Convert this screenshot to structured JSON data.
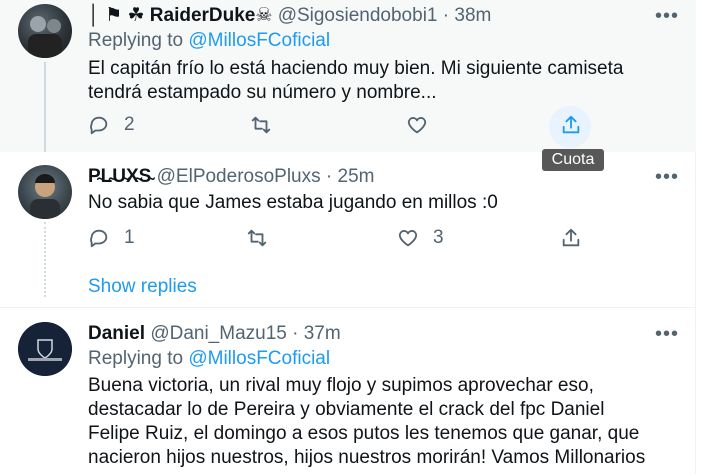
{
  "tooltip": "Cuota",
  "show_replies": "Show replies",
  "tweets": [
    {
      "name": "│ ⚑ ☘ RaiderDuke☠",
      "handle": "@Sigosiendobobi1",
      "time": "38m",
      "replying_prefix": "Replying to",
      "replying_to": "@MillosFCoficial",
      "text_lines": [
        "El capitán frío lo está haciendo muy bien. Mi siguiente camiseta",
        "tendrá estampado su número y nombre..."
      ],
      "reply_count": "2",
      "retweet_count": "",
      "like_count": ""
    },
    {
      "name": "P̴L̴U̴X̴S̴",
      "handle": "@ElPoderosoPluxs",
      "time": "25m",
      "text_lines": [
        "No sabia que James estaba jugando en millos :0"
      ],
      "reply_count": "1",
      "retweet_count": "",
      "like_count": "3"
    },
    {
      "name": "Daniel",
      "handle": "@Dani_Mazu15",
      "time": "37m",
      "replying_prefix": "Replying to",
      "replying_to": "@MillosFCoficial",
      "text_lines": [
        "Buena victoria, un rival muy flojo y supimos aprovechar eso,",
        "destacadar lo de Pereira y obviamente el crack del fpc Daniel",
        "Felipe Ruiz, el domingo a esos putos les tenemos que ganar, que",
        "nacieron hijos nuestros, hijos nuestros morirán! Vamos Millonarios"
      ]
    }
  ],
  "icons": {
    "more": "more-horizontal-icon",
    "reply": "reply-bubble-icon",
    "retweet": "retweet-icon",
    "like": "heart-icon",
    "share": "share-upload-icon"
  },
  "colors": {
    "accent": "#1d9bf0",
    "secondary_text": "#536471",
    "hover_bg": "#f7f9f9",
    "tooltip_bg": "#585858"
  }
}
